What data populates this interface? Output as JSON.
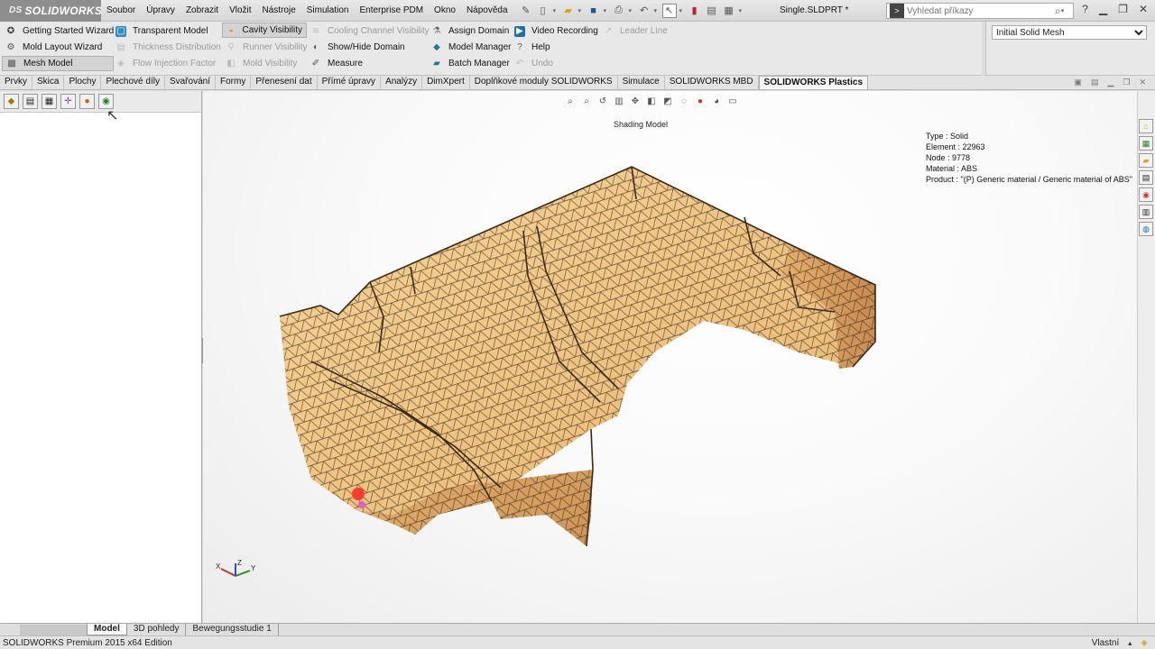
{
  "titlebar": {
    "logo_prefix": "DS",
    "logo_text": "SOLIDWORKS",
    "menus": [
      "Soubor",
      "Úpravy",
      "Zobrazit",
      "Vložit",
      "Nástroje",
      "Simulation",
      "Enterprise PDM",
      "Okno",
      "Nápověda"
    ],
    "document_title": "Single.SLDPRT *",
    "search_placeholder": "Vyhledat příkazy"
  },
  "ribbon": {
    "col1": [
      "Getting Started Wizard",
      "Mold Layout Wizard",
      "Mesh Model"
    ],
    "col2": [
      "Transparent Model",
      "Thickness Distribution",
      "Flow Injection Factor"
    ],
    "col3": [
      "Cavity Visibility",
      "Runner Visibility",
      "Mold Visibility"
    ],
    "col4": [
      "Cooling Channel Visibility",
      "Show/Hide Domain",
      "Measure"
    ],
    "col5": [
      "Assign Domain",
      "Model Manager",
      "Batch Manager"
    ],
    "col6": [
      "Video Recording",
      "Help",
      "Undo"
    ],
    "col7": [
      "Leader Line"
    ],
    "mesh_select": "Initial Solid Mesh"
  },
  "tabs": [
    "Prvky",
    "Skica",
    "Plochy",
    "Plechové díly",
    "Svařování",
    "Formy",
    "Přenesení dat",
    "Přímé úpravy",
    "Analýzy",
    "DimXpert",
    "Doplňkové moduly SOLIDWORKS",
    "Simulace",
    "SOLIDWORKS MBD",
    "SOLIDWORKS Plastics"
  ],
  "viewport": {
    "shading_label": "Shading Model",
    "info": {
      "type": "Type : Solid",
      "element": "Element : 22963",
      "node": "Node : 9778",
      "material": "Material : ABS",
      "product": "Product :   \"(P)  Generic material / Generic material of ABS\""
    },
    "triad_x": "X",
    "triad_y": "Y",
    "triad_z": "Z"
  },
  "bottom_tabs": [
    "Model",
    "3D pohledy",
    "Bewegungsstudie 1"
  ],
  "status": {
    "left": "SOLIDWORKS Premium 2015 x64 Edition",
    "right": "Vlastní"
  },
  "colors": {
    "mesh_fill_light": "#f2c985",
    "mesh_fill_dark": "#c98a52",
    "mesh_line": "#3a2a1a",
    "accent_red": "#ff3b30"
  }
}
